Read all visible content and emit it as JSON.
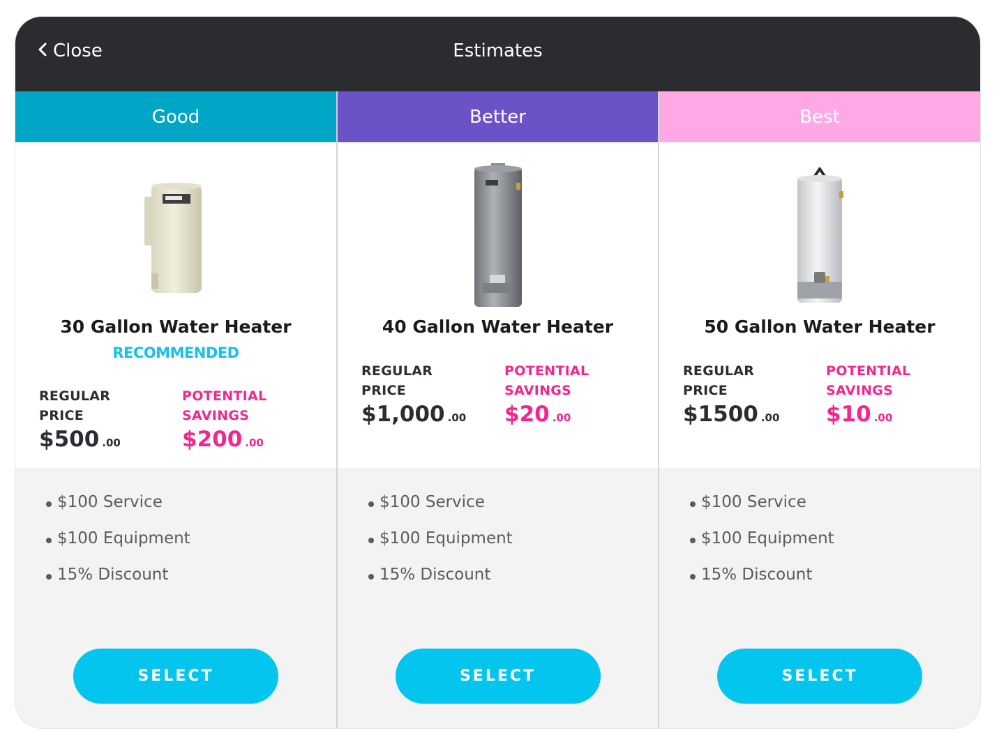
{
  "header": {
    "close_label": "Close",
    "title": "Estimates",
    "close_icon": "chevron-left-icon"
  },
  "colors": {
    "topbar": "#2b2c2f",
    "good": "#00a6c6",
    "better": "#6b52c6",
    "best": "#ffa8e6",
    "recommended": "#17c0ea",
    "savings": "#f2268f",
    "select_button": "#04c5ee",
    "features_bg": "#f3f3f3"
  },
  "tiers": [
    {
      "tier_label": "Good",
      "product_name": "30 Gallon Water Heater",
      "badge": "RECOMMENDED",
      "regular_label_1": "REGULAR",
      "regular_label_2": "PRICE",
      "regular_price": "$500",
      "regular_cents": ".00",
      "savings_label_1": "POTENTIAL",
      "savings_label_2": "SAVINGS",
      "savings": "$200",
      "savings_cents": ".00",
      "features": [
        "$100 Service",
        "$100 Equipment",
        "15% Discount"
      ],
      "button": "SELECT"
    },
    {
      "tier_label": "Better",
      "product_name": "40 Gallon Water Heater",
      "badge": "",
      "regular_label_1": "REGULAR",
      "regular_label_2": "PRICE",
      "regular_price": "$1,000",
      "regular_cents": ".00",
      "savings_label_1": "POTENTIAL",
      "savings_label_2": "SAVINGS",
      "savings": "$20",
      "savings_cents": ".00",
      "features": [
        "$100 Service",
        "$100 Equipment",
        "15% Discount"
      ],
      "button": "SELECT"
    },
    {
      "tier_label": "Best",
      "product_name": "50 Gallon Water Heater",
      "badge": "",
      "regular_label_1": "REGULAR",
      "regular_label_2": "PRICE",
      "regular_price": "$1500",
      "regular_cents": ".00",
      "savings_label_1": "POTENTIAL",
      "savings_label_2": "SAVINGS",
      "savings": "$10",
      "savings_cents": ".00",
      "features": [
        "$100 Service",
        "$100 Equipment",
        "15% Discount"
      ],
      "button": "SELECT"
    }
  ]
}
